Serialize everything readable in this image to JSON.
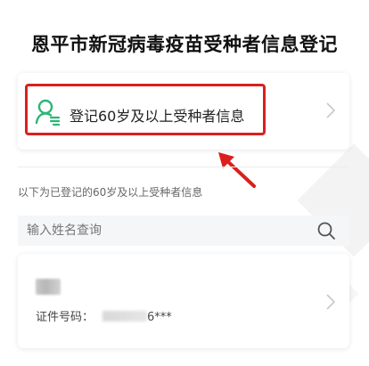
{
  "page": {
    "title": "恩平市新冠病毒疫苗受种者信息登记"
  },
  "register": {
    "label": "登记60岁及以上受种者信息",
    "icon": "person-list-icon",
    "icon_color": "#2bb673",
    "highlight_color": "#d9201d"
  },
  "list": {
    "hint": "以下为已登记的60岁及以上受种者信息"
  },
  "search": {
    "placeholder": "输入姓名查询",
    "value": "",
    "icon": "search-icon"
  },
  "records": [
    {
      "name": "",
      "id_label": "证件号码：",
      "id_suffix": "6***"
    }
  ]
}
